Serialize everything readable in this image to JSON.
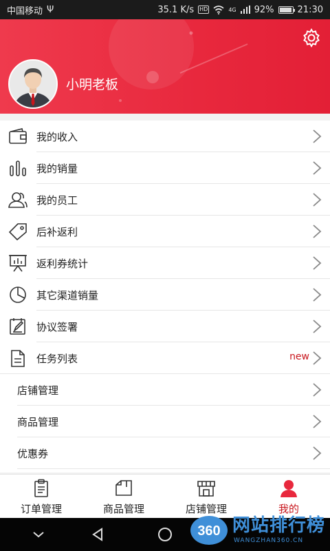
{
  "status_bar": {
    "carrier": "中国移动",
    "usb": "Ψ",
    "speed": "35.1 K/s",
    "hd": "HD",
    "network": "4G",
    "battery": "92%",
    "battery_level": 0.92,
    "time": "21:30"
  },
  "header": {
    "user_name": "小明老板",
    "settings_icon": "gear-icon"
  },
  "menu": {
    "items": [
      {
        "label": "我的收入",
        "icon": "wallet-icon"
      },
      {
        "label": "我的销量",
        "icon": "bar-chart-icon"
      },
      {
        "label": "我的员工",
        "icon": "users-icon"
      },
      {
        "label": "后补返利",
        "icon": "tag-icon"
      },
      {
        "label": "返利券统计",
        "icon": "presentation-chart-icon"
      },
      {
        "label": "其它渠道销量",
        "icon": "pie-chart-icon"
      },
      {
        "label": "协议签署",
        "icon": "contract-edit-icon"
      },
      {
        "label": "任务列表",
        "icon": "document-list-icon",
        "badge": "new"
      },
      {
        "label": "店铺管理"
      },
      {
        "label": "商品管理"
      },
      {
        "label": "优惠券"
      }
    ]
  },
  "tabs": [
    {
      "label": "订单管理",
      "icon": "clipboard-icon",
      "active": false
    },
    {
      "label": "商品管理",
      "icon": "box-icon",
      "active": false
    },
    {
      "label": "店铺管理",
      "icon": "store-icon",
      "active": false
    },
    {
      "label": "我的",
      "icon": "person-icon",
      "active": true
    }
  ],
  "watermark": {
    "logo": "360",
    "text": "网站排行榜",
    "sub": "WANGZHAN360.CN"
  },
  "colors": {
    "brand_red": "#e8283d",
    "active_red": "#c8161d",
    "badge_red": "#c8161d"
  }
}
